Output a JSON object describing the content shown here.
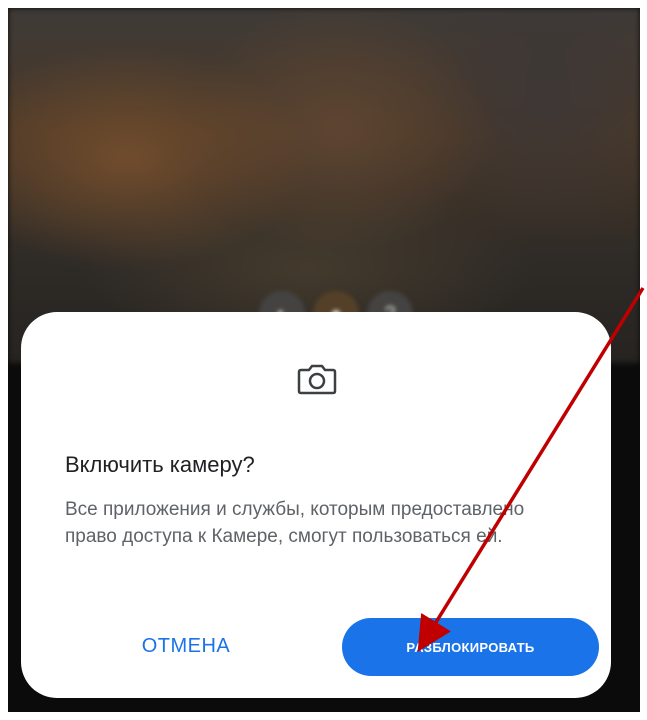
{
  "camera_preview": {
    "controls": [
      {
        "icon": "effects-icon"
      },
      {
        "icon": "capture-icon"
      },
      {
        "icon": "help-icon"
      }
    ]
  },
  "dialog": {
    "icon": "camera-icon",
    "title": "Включить камеру?",
    "body": "Все приложения и службы, которым предоставлено право доступа к Камере, смогут пользоваться ей.",
    "cancel_label": "ОТМЕНА",
    "unlock_label": "РАЗБЛОКИРОВАТЬ"
  },
  "annotation": {
    "arrow_color": "#c00000",
    "accent_color": "#1a73e8"
  }
}
